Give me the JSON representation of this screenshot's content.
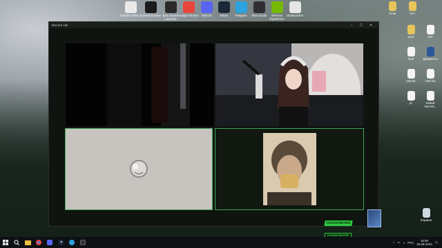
{
  "desktop": {
    "top_icons": [
      {
        "label": "Counter-Strike 2",
        "icon": "cs2-icon",
        "color": "#e9e9e9"
      },
      {
        "label": "LGHUB Кнопки",
        "icon": "lghub-icon",
        "color": "#1b1b1b"
      },
      {
        "label": "Epic Games Launcher",
        "icon": "epic-icon",
        "color": "#2a2a2a"
      },
      {
        "label": "Google Chrome",
        "icon": "chrome-icon",
        "color": "#e8453c"
      },
      {
        "label": "Discord",
        "icon": "discord-icon",
        "color": "#5865f2"
      },
      {
        "label": "Steam",
        "icon": "steam-icon",
        "color": "#1b2838"
      },
      {
        "label": "Telegram",
        "icon": "telegram-icon",
        "color": "#2aa3df"
      },
      {
        "label": "OBS Studio",
        "icon": "obs-icon",
        "color": "#302e31"
      },
      {
        "label": "GeForce Experience",
        "icon": "geforce-icon",
        "color": "#76b900"
      },
      {
        "label": "nitrolauncher",
        "icon": "nitro-icon",
        "color": "#e6e6e6"
      }
    ],
    "right_icons": [
      {
        "label": "оч-ки",
        "icon": "archive-icon"
      },
      {
        "label": "тест",
        "icon": "folder-icon"
      },
      {
        "label": "2123",
        "icon": "archive-icon"
      },
      {
        "label": "text",
        "icon": "file-icon"
      },
      {
        "label": "mod",
        "icon": "file-icon"
      },
      {
        "label": "Документы",
        "icon": "word-icon"
      },
      {
        "label": "роутер",
        "icon": "file-icon"
      },
      {
        "label": "очистка",
        "icon": "file-icon"
      },
      {
        "label": "pr",
        "icon": "file-icon"
      },
      {
        "label": "Новый текстов...",
        "icon": "file-icon"
      },
      {
        "label": "Корзина",
        "icon": "recycle-bin-icon"
      }
    ]
  },
  "window": {
    "title": "Discord call",
    "controls": [
      "–",
      "☐",
      "✕"
    ]
  },
  "overlay": {
    "line1": "ПОПОЛНЕНИЕ",
    "line2": "НОШЕЛЬКОВ"
  },
  "taskbar": {
    "apps": [
      "windows-icon",
      "search-icon",
      "explorer-icon",
      "chrome-icon",
      "discord-icon",
      "steam-icon",
      "telegram-icon",
      "obs-icon"
    ],
    "tray": {
      "lang": "РУС",
      "time": "18:50",
      "date": "25.08.2023"
    }
  },
  "colors": {
    "active_border": "#3fa55b",
    "window_bg": "#101410"
  }
}
